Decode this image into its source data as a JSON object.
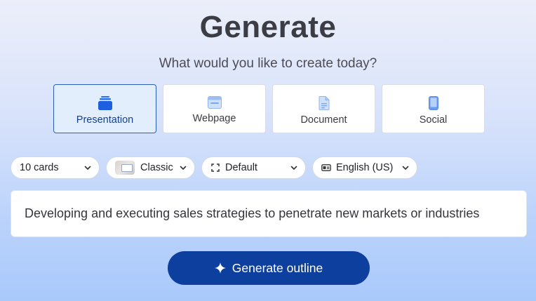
{
  "header": {
    "title": "Generate",
    "subtitle": "What would you like to create today?"
  },
  "types": [
    {
      "label": "Presentation",
      "icon": "presentation-stack-icon",
      "selected": true
    },
    {
      "label": "Webpage",
      "icon": "webpage-icon",
      "selected": false
    },
    {
      "label": "Document",
      "icon": "document-icon",
      "selected": false
    },
    {
      "label": "Social",
      "icon": "phone-icon",
      "selected": false
    }
  ],
  "options": {
    "cards": "10 cards",
    "theme": "Classic",
    "layout": "Default",
    "language": "English (US)"
  },
  "prompt": {
    "value": "Developing and executing sales strategies to penetrate new markets or industries"
  },
  "actions": {
    "generate_label": "Generate outline"
  },
  "colors": {
    "accent": "#0d3f9f",
    "selected_border": "#2c5fb8",
    "selected_bg": "#e3eefd"
  }
}
